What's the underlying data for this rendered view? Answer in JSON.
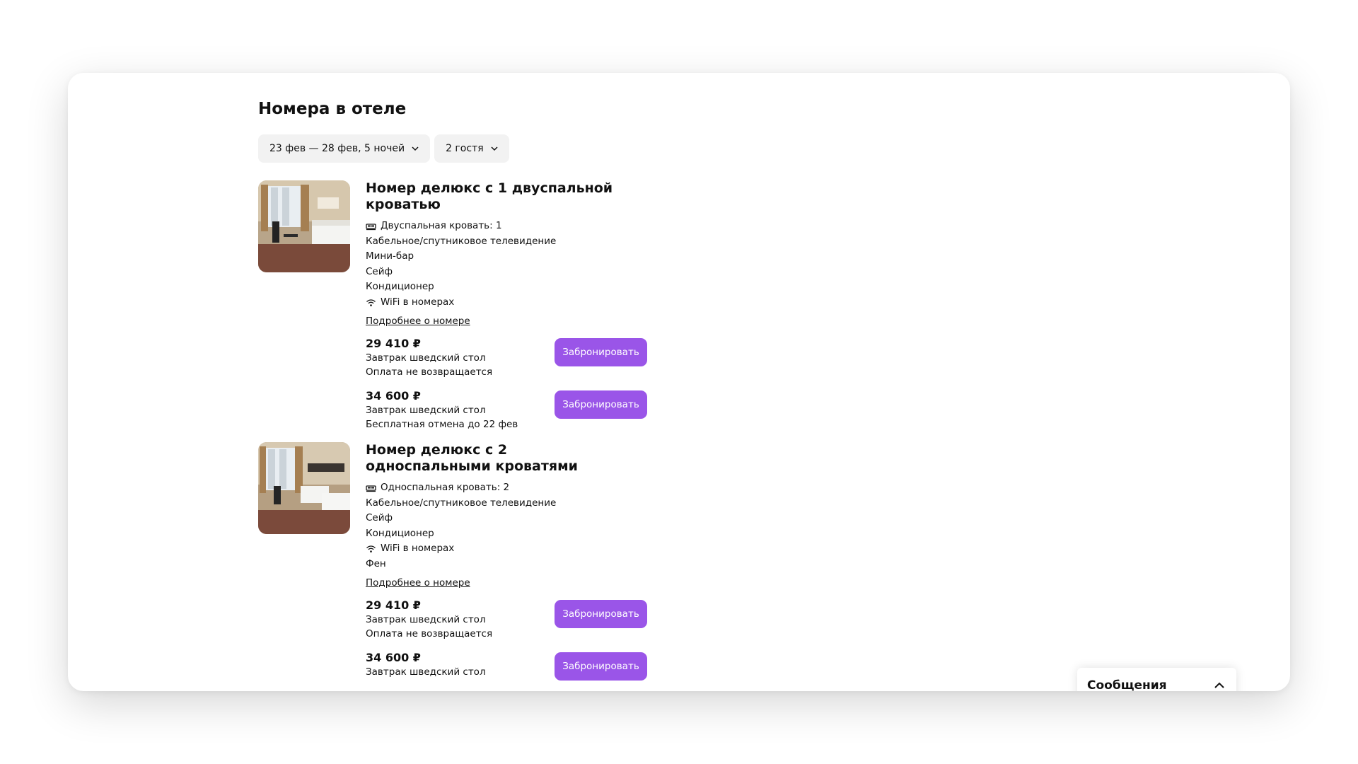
{
  "page": {
    "title": "Номера в отеле",
    "filters": {
      "dates": "23 фев — 28 фев, 5 ночей",
      "guests": "2 гостя"
    }
  },
  "rooms": [
    {
      "title": "Номер делюкс с 1 двуспальной кроватью",
      "features": [
        {
          "icon": "bed-icon",
          "text": "Двуспальная кровать: 1"
        },
        {
          "icon": "",
          "text": "Кабельное/спутниковое телевидение"
        },
        {
          "icon": "",
          "text": "Мини-бар"
        },
        {
          "icon": "",
          "text": "Сейф"
        },
        {
          "icon": "",
          "text": "Кондиционер"
        },
        {
          "icon": "wifi-icon",
          "text": "WiFi в номерах"
        }
      ],
      "more_link": "Подробнее о номере",
      "rates": [
        {
          "price": "29 410 ₽",
          "meal": "Завтрак шведский стол",
          "policy": "Оплата не возвращается",
          "button": "Забронировать"
        },
        {
          "price": "34 600 ₽",
          "meal": "Завтрак шведский стол",
          "policy": "Бесплатная отмена до 22 фев",
          "button": "Забронировать"
        }
      ]
    },
    {
      "title": "Номер делюкс с 2 односпальными кроватями",
      "features": [
        {
          "icon": "bed-icon",
          "text": "Односпальная кровать: 2"
        },
        {
          "icon": "",
          "text": "Кабельное/спутниковое телевидение"
        },
        {
          "icon": "",
          "text": "Сейф"
        },
        {
          "icon": "",
          "text": "Кондиционер"
        },
        {
          "icon": "wifi-icon",
          "text": "WiFi в номерах"
        },
        {
          "icon": "",
          "text": "Фен"
        }
      ],
      "more_link": "Подробнее о номере",
      "rates": [
        {
          "price": "29 410 ₽",
          "meal": "Завтрак шведский стол",
          "policy": "Оплата не возвращается",
          "button": "Забронировать"
        },
        {
          "price": "34 600 ₽",
          "meal": "Завтрак шведский стол",
          "policy": "",
          "button": "Забронировать"
        }
      ]
    }
  ],
  "messages": {
    "label": "Сообщения"
  },
  "colors": {
    "accent": "#9a55e8",
    "chip_bg": "#f2f2f2"
  }
}
